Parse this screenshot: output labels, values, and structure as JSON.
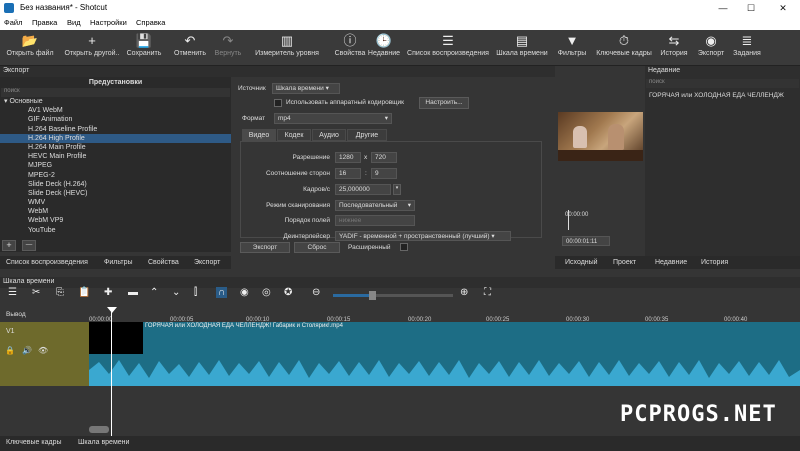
{
  "window": {
    "title": "Без названия* - Shotcut",
    "minimize": "—",
    "maximize": "☐",
    "close": "✕"
  },
  "menu": [
    "Файл",
    "Правка",
    "Вид",
    "Настройки",
    "Справка"
  ],
  "toolbar": [
    {
      "label": "Открыть файл",
      "icon": "📂"
    },
    {
      "label": "Открыть другой..",
      "icon": "+"
    },
    {
      "label": "Сохранить",
      "icon": "💾"
    },
    {
      "label": "Отменить",
      "icon": "↶"
    },
    {
      "label": "Вернуть",
      "icon": "↷",
      "disabled": true
    },
    {
      "label": "Измеритель уровня",
      "icon": "▥"
    },
    {
      "label": "Свойства",
      "icon": "ⓘ"
    },
    {
      "label": "Недавние",
      "icon": "🕒"
    },
    {
      "label": "Список воспроизведения",
      "icon": "☰"
    },
    {
      "label": "Шкала времени",
      "icon": "▤"
    },
    {
      "label": "Фильтры",
      "icon": "▼"
    },
    {
      "label": "Ключевые кадры",
      "icon": "⏱"
    },
    {
      "label": "История",
      "icon": "⇆"
    },
    {
      "label": "Экспорт",
      "icon": "◉"
    },
    {
      "label": "Задания",
      "icon": "≣"
    }
  ],
  "export": {
    "panel_title": "Экспорт",
    "presets_title": "Предустановки",
    "search_placeholder": "поиск",
    "group": "▾ Основные",
    "presets": [
      "AV1 WebM",
      "GIF Animation",
      "H.264 Baseline Profile",
      "H.264 High Profile",
      "H.264 Main Profile",
      "HEVC Main Profile",
      "MJPEG",
      "MPEG-2",
      "Slide Deck (H.264)",
      "Slide Deck (HEVC)",
      "WMV",
      "WebM",
      "WebM VP9",
      "YouTube"
    ],
    "selected_index": 3,
    "add": "+",
    "remove": "—",
    "source_label": "Источник",
    "source_value": "Шкала времени",
    "hw_label": "Использовать аппаратный кодировщик",
    "configure": "Настроить...",
    "format_label": "Формат",
    "format_value": "mp4",
    "tabs": [
      "Видео",
      "Кодек",
      "Аудио",
      "Другие"
    ],
    "resolution_label": "Разрешение",
    "res_w": "1280",
    "res_x": "x",
    "res_h": "720",
    "aspect_label": "Соотношение сторон",
    "aspect_w": "16",
    "aspect_sep": ":",
    "aspect_h": "9",
    "fps_label": "Кадров/с",
    "fps_value": "25,000000",
    "scan_label": "Режим сканирования",
    "scan_value": "Последовательный",
    "field_order_label": "Порядок полей",
    "field_order_value": "нижнее",
    "deint_label": "Деинтерлейсер",
    "deint_value": "YADIF - временной + пространственный (лучший)",
    "export_btn": "Экспорт",
    "reset_btn": "Сброс",
    "advanced": "Расширенный"
  },
  "left_tabs": [
    "Список воспроизведения",
    "Фильтры",
    "Свойства",
    "Экспорт"
  ],
  "preview": {
    "time1": "00:00:00",
    "time2": "00:00:01:11",
    "tabs": [
      "Исходный",
      "Проект"
    ]
  },
  "recent": {
    "title": "Недавние",
    "search_placeholder": "поиск",
    "item": "ГОРЯЧАЯ или ХОЛОДНАЯ ЕДА ЧЕЛЛЕНДЖ",
    "tabs": [
      "Недавние",
      "История"
    ]
  },
  "timeline": {
    "title": "Шкала времени",
    "output": "Вывод",
    "track": "V1",
    "ticks": [
      "00:00:00",
      "00:00:05",
      "00:00:10",
      "00:00:15",
      "00:00:20",
      "00:00:25",
      "00:00:30",
      "00:00:35",
      "00:00:40"
    ],
    "clip": "ГОРЯЧАЯ или ХОЛОДНАЯ ЕДА ЧЕЛЛЕНДЖ! Габарик и Столярик!.mp4",
    "bottom_tabs": [
      "Ключевые кадры",
      "Шкала времени"
    ]
  },
  "watermark": "PCPROGS.NET"
}
